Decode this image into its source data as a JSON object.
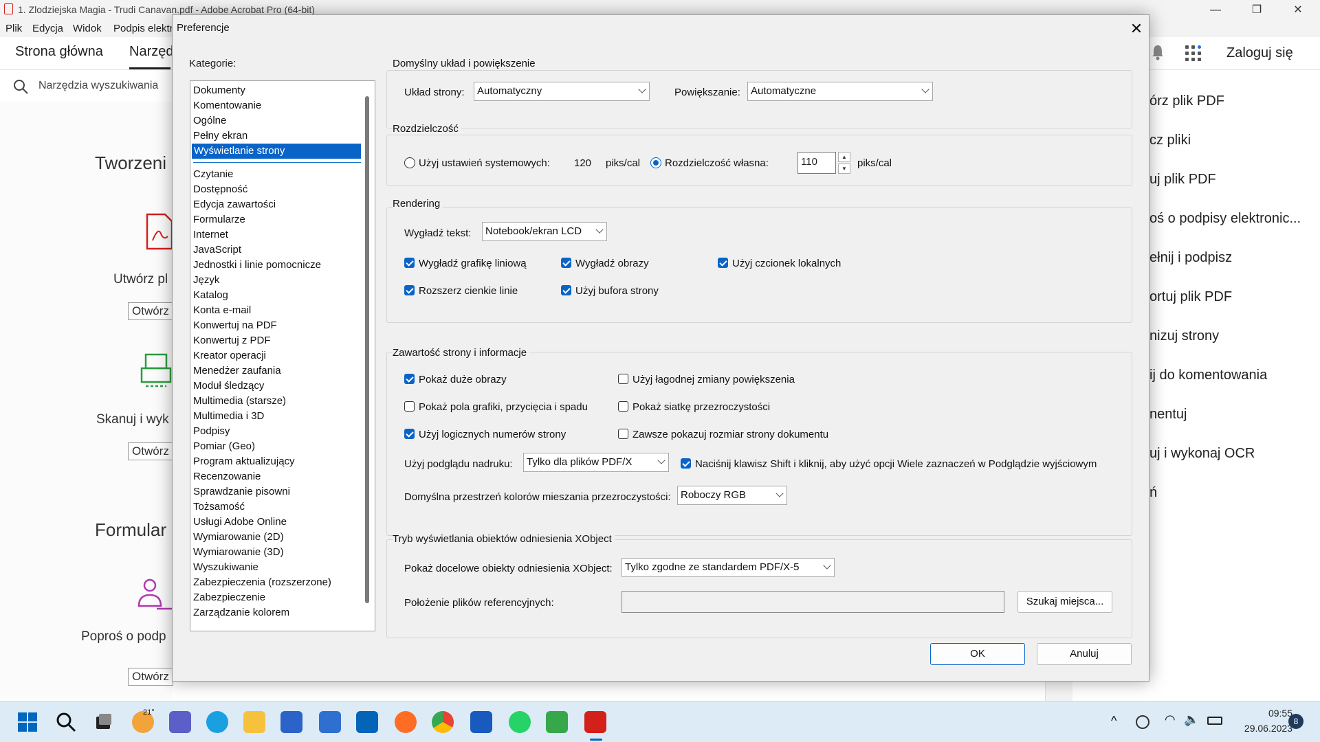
{
  "window": {
    "title": "1. Zlodziejska Magia - Trudi Canavan.pdf - Adobe Acrobat Pro (64-bit)",
    "minimize": "—",
    "maximize": "❐",
    "close": "✕"
  },
  "menu": {
    "items": [
      "Plik",
      "Edycja",
      "Widok",
      "Podpis elektr"
    ]
  },
  "app_tabs": {
    "home": "Strona główna",
    "tools": "Narzęd",
    "login": "Zaloguj się"
  },
  "search": {
    "label": "Narzędzia wyszukiwania"
  },
  "background": {
    "create_heading": "Tworzeni",
    "forms_heading": "Formular",
    "create_pdf_label": "Utwórz pl",
    "scan_label": "Skanuj i wyk",
    "request_sign_label": "Poproś o podp",
    "open_btn": "Otwórz"
  },
  "right_panel": {
    "items": [
      "órz plik PDF",
      "cz pliki",
      "uj plik PDF",
      "oś o podpisy elektronic...",
      "ełnij i podpisz",
      "ortuj plik PDF",
      "nizuj strony",
      "ij do komentowania",
      "nentuj",
      "uj i wykonaj OCR",
      "ń"
    ]
  },
  "dialog": {
    "title": "Preferencje",
    "close": "✕",
    "categories_label": "Kategorie:",
    "categories_top": [
      "Dokumenty",
      "Komentowanie",
      "Ogólne",
      "Pełny ekran",
      "Wyświetlanie strony"
    ],
    "categories": [
      "Czytanie",
      "Dostępność",
      "Edycja zawartości",
      "Formularze",
      "Internet",
      "JavaScript",
      "Jednostki i linie pomocnicze",
      "Język",
      "Katalog",
      "Konta e-mail",
      "Konwertuj na PDF",
      "Konwertuj z PDF",
      "Kreator operacji",
      "Menedżer zaufania",
      "Moduł śledzący",
      "Multimedia (starsze)",
      "Multimedia i 3D",
      "Podpisy",
      "Pomiar (Geo)",
      "Program aktualizujący",
      "Recenzowanie",
      "Sprawdzanie pisowni",
      "Tożsamość",
      "Usługi Adobe Online",
      "Wymiarowanie (2D)",
      "Wymiarowanie (3D)",
      "Wyszukiwanie",
      "Zabezpieczenia (rozszerzone)",
      "Zabezpieczenie",
      "Zarządzanie kolorem"
    ],
    "layout": {
      "title": "Domyślny układ i powiększenie",
      "page_layout_label": "Układ strony:",
      "page_layout_value": "Automatyczny",
      "zoom_label": "Powiększanie:",
      "zoom_value": "Automatyczne"
    },
    "resolution": {
      "title": "Rozdzielczość",
      "system_label": "Użyj ustawień systemowych:",
      "system_value": "120",
      "unit": "piks/cal",
      "custom_label": "Rozdzielczość własna:",
      "custom_value": "110",
      "custom_selected": true
    },
    "rendering": {
      "title": "Rendering",
      "smooth_text_label": "Wygładź tekst:",
      "smooth_text_value": "Notebook/ekran LCD",
      "options": [
        {
          "label": "Wygładź grafikę liniową",
          "checked": true
        },
        {
          "label": "Wygładź obrazy",
          "checked": true
        },
        {
          "label": "Użyj czcionek lokalnych",
          "checked": true
        },
        {
          "label": "Rozszerz cienkie linie",
          "checked": true
        },
        {
          "label": "Użyj bufora strony",
          "checked": true
        }
      ]
    },
    "content": {
      "title": "Zawartość strony i informacje",
      "options": [
        {
          "label": "Pokaż duże obrazy",
          "checked": true
        },
        {
          "label": "Użyj łagodnej zmiany powiększenia",
          "checked": false
        },
        {
          "label": "Pokaż pola grafiki, przycięcia i spadu",
          "checked": false
        },
        {
          "label": "Pokaż siatkę przezroczystości",
          "checked": false
        },
        {
          "label": "Użyj logicznych numerów strony",
          "checked": true
        },
        {
          "label": "Zawsze pokazuj rozmiar strony dokumentu",
          "checked": false
        }
      ],
      "overprint_label": "Użyj podglądu nadruku:",
      "overprint_value": "Tylko dla plików PDF/X",
      "shift_click_label": "Naciśnij klawisz Shift i kliknij, aby użyć opcji Wiele zaznaczeń w Podglądzie wyjściowym",
      "shift_click_checked": true,
      "blend_label": "Domyślna przestrzeń kolorów mieszania przezroczystości:",
      "blend_value": "Roboczy RGB"
    },
    "xobject": {
      "title": "Tryb wyświetlania obiektów odniesienia XObject",
      "show_label": "Pokaż docelowe obiekty odniesienia XObject:",
      "show_value": "Tylko zgodne ze standardem PDF/X-5",
      "location_label": "Położenie plików referencyjnych:",
      "location_value": "",
      "browse_btn": "Szukaj miejsca..."
    },
    "ok": "OK",
    "cancel": "Anuluj"
  },
  "taskbar": {
    "weather": "21°",
    "time": "09:55",
    "date": "29.06.2023",
    "notifications": "8"
  },
  "colors": {
    "accent": "#0a64c8",
    "acrobat_red": "#d4201b"
  }
}
